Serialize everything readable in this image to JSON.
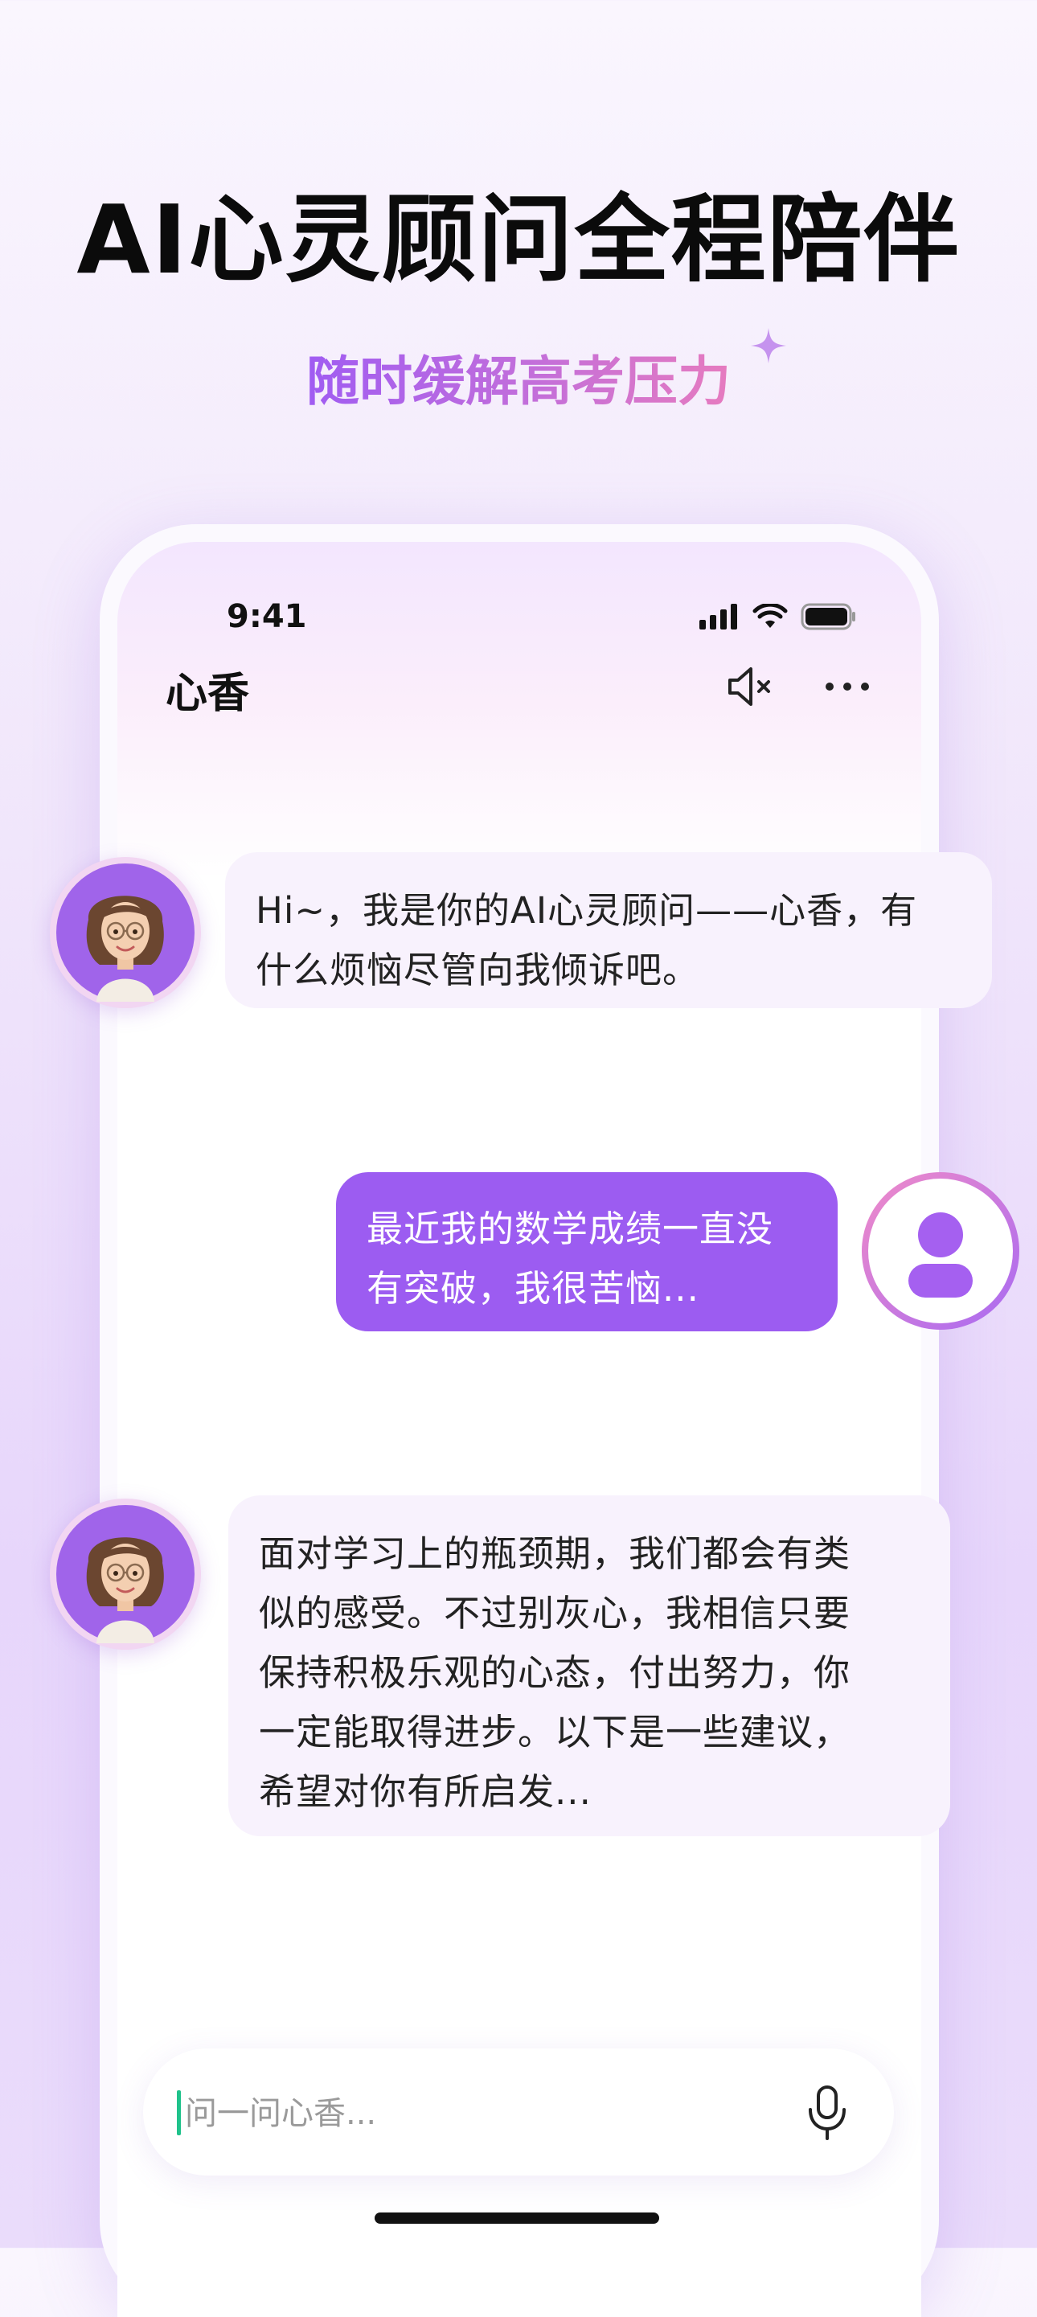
{
  "hero": {
    "title": "AI心灵顾问全程陪伴",
    "subtitle": "随时缓解高考压力"
  },
  "status_bar": {
    "time": "9:41",
    "icons": [
      "signal-icon",
      "wifi-icon",
      "battery-icon"
    ]
  },
  "header": {
    "title": "心香",
    "actions": [
      "speaker-mute-icon",
      "more-icon"
    ]
  },
  "messages": [
    {
      "sender": "ai",
      "lines": [
        "Hi~，我是你的AI心灵顾问——心香，有",
        "什么烦恼尽管向我倾诉吧。"
      ]
    },
    {
      "sender": "user",
      "lines": [
        "最近我的数学成绩一直没",
        "有突破，我很苦恼..."
      ]
    },
    {
      "sender": "ai",
      "lines": [
        "面对学习上的瓶颈期，我们都会有类",
        "似的感受。不过别灰心，我相信只要",
        "保持积极乐观的心态，付出努力，你",
        "一定能取得进步。以下是一些建议，",
        "希望对你有所启发..."
      ]
    }
  ],
  "input": {
    "placeholder": "问一问心香...",
    "value": ""
  },
  "colors": {
    "accent": "#9c5cf1",
    "ai_bubble": "#f8f2fd",
    "subtitle_gradient": [
      "#a05cf2",
      "#e67bbf"
    ],
    "cursor": "#1fc28b"
  }
}
